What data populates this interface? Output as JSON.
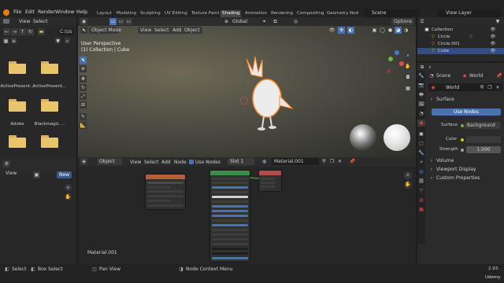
{
  "top_menu": {
    "items": [
      "File",
      "Edit",
      "Render",
      "Window",
      "Help"
    ],
    "workspaces": [
      "Layout",
      "Modeling",
      "Sculpting",
      "UV Editing",
      "Texture Paint",
      "Shading",
      "Animation",
      "Rendering",
      "Compositing",
      "Geometry Nod"
    ],
    "active_workspace": "Shading",
    "scene_label": "Scene",
    "view_layer_label": "View Layer"
  },
  "file_browser": {
    "menu": [
      "View",
      "Select"
    ],
    "path": "C:\\Us",
    "folders": [
      "ActivePresent...",
      "ActivePresent...",
      "Adobe",
      "Blackmagic ...",
      "",
      ""
    ]
  },
  "viewport": {
    "header": {
      "mode": "Object Mode",
      "menus": [
        "View",
        "Select",
        "Add",
        "Object"
      ],
      "orientation": "Global",
      "options": "Options"
    },
    "overlay_line1": "User Perspective",
    "overlay_line2": "(1) Collection | Cube"
  },
  "node_editor": {
    "header": {
      "type": "Object",
      "menus": [
        "View",
        "Select",
        "Add",
        "Node"
      ],
      "use_nodes": "Use Nodes",
      "slot": "Slot 1",
      "material": "Material.001"
    },
    "material_label": "Material.001"
  },
  "left_panel": {
    "view": "View",
    "new_button": "New"
  },
  "outliner": {
    "items": [
      {
        "label": "Collection",
        "selected": false
      },
      {
        "label": "Circle",
        "selected": false
      },
      {
        "label": "Circle.001",
        "selected": false
      },
      {
        "label": "Cube",
        "selected": true
      }
    ]
  },
  "properties": {
    "scene_label": "Scene",
    "world_label": "World",
    "world_name": "World",
    "surface_panel": "Surface",
    "use_nodes_button": "Use Nodes",
    "surface_label": "Surface",
    "surface_value": "Background",
    "color_label": "Color",
    "strength_label": "Strength",
    "strength_value": "1.000",
    "panels": [
      "Volume",
      "Viewport Display",
      "Custom Properties"
    ]
  },
  "status_bar": {
    "items": [
      "Select",
      "Box Select",
      "Pan View",
      "Node Context Menu"
    ],
    "version": "2.93.",
    "watermark": "Udemy"
  },
  "colors": {
    "accent": "#4772b3",
    "folder": "#e8c46a",
    "selection": "#334d80",
    "node_green": "#3e8c4a",
    "node_red": "#b34a4a",
    "node_orange": "#b3603a"
  }
}
